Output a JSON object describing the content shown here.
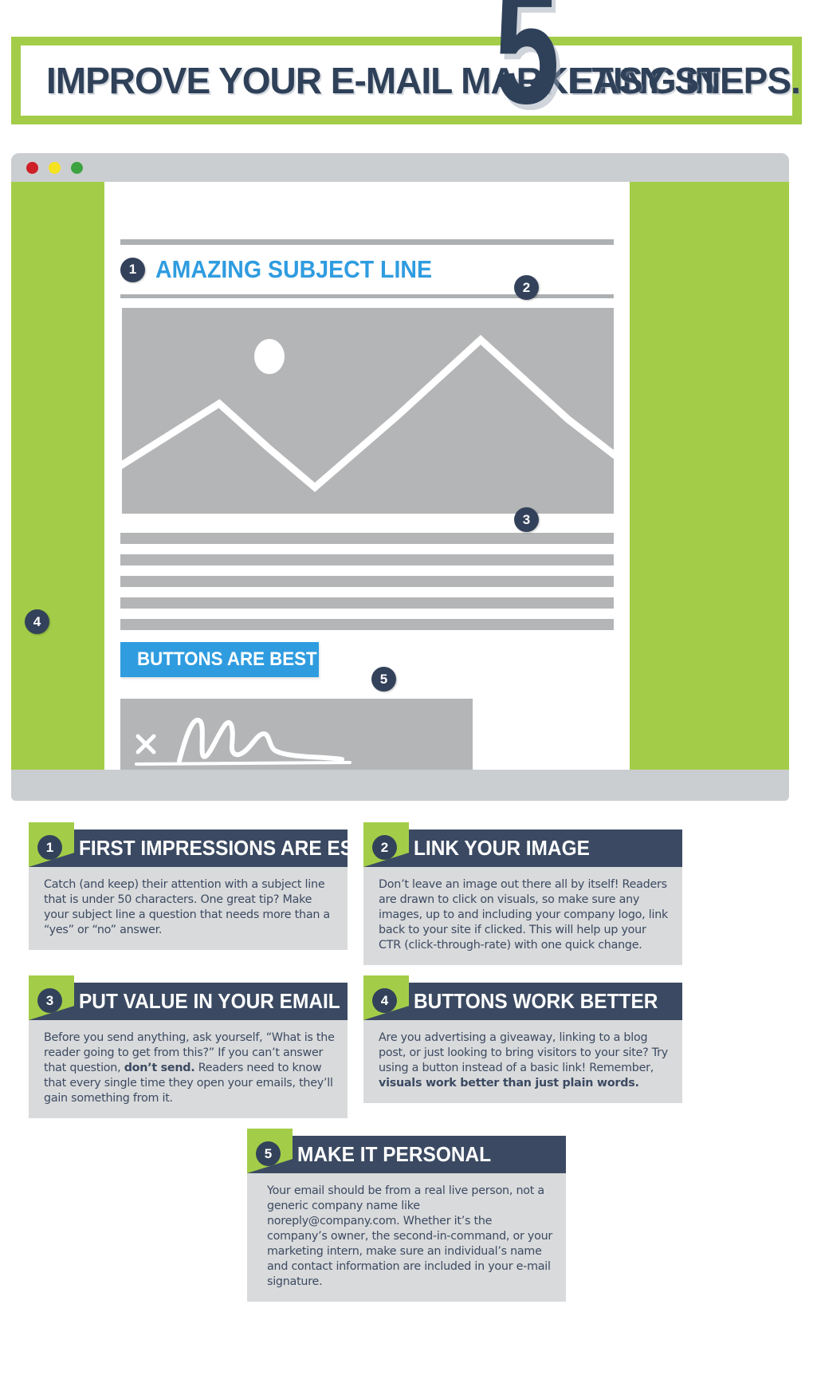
{
  "header": {
    "title_pre": "IMPROVE YOUR E-MAIL MARKETING IN",
    "big_number": "5",
    "title_post": "EASY STEPS."
  },
  "browser": {
    "traffic_lights": [
      "close-dot-red",
      "minimize-dot-yellow",
      "maximize-dot-green"
    ]
  },
  "email_preview": {
    "subject_marker": "1",
    "subject_line": "AMAZING SUBJECT LINE",
    "image_marker": "2",
    "body_marker": "3",
    "button_marker": "4",
    "button_label": "BUTTONS ARE BEST",
    "signature_marker": "5",
    "body_line_count": 5
  },
  "cards": [
    {
      "number": "1",
      "title": "FIRST IMPRESSIONS ARE ESSENTIAL",
      "body": "Catch (and keep) their attention with a subject line that is under 50 characters. One great tip? Make your subject line a question that needs more than a “yes” or “no” answer."
    },
    {
      "number": "2",
      "title": "LINK YOUR IMAGE",
      "body": "Don’t leave an image out there all by itself! Readers are drawn to click on visuals, so make sure any images, up to and including your company logo, link back to your site if clicked. This will help up your CTR (click-through-rate) with one quick change."
    },
    {
      "number": "3",
      "title": "PUT VALUE IN YOUR EMAIL",
      "body_part1": "Before you send anything, ask yourself, “What is the reader going to get from this?” If you can’t answer that question, ",
      "body_bold": "don’t send.",
      "body_part2": " Readers need to know that every single time they open your emails, they’ll gain something from it."
    },
    {
      "number": "4",
      "title": "BUTTONS WORK BETTER",
      "body_part1": "Are you advertising a giveaway, linking to a blog post, or just looking to bring visitors to your site? Try using a button instead of a basic link! Remember, ",
      "body_bold": "visuals work better than just plain words.",
      "body_part2": ""
    },
    {
      "number": "5",
      "title": "MAKE IT PERSONAL",
      "body": "Your email should be from a real live person, not a generic company name like noreply@company.com. Whether it’s the company’s owner, the second-in-command, or your marketing intern, make sure an individual’s name and contact information are included in your e-mail signature."
    }
  ],
  "colors": {
    "green": "#a3cd48",
    "navy": "#33425a",
    "card_head": "#3b4a62",
    "blue": "#2f9ce0",
    "gray_chrome": "#cbced1",
    "gray_placeholder": "#b3b5b7",
    "card_body_bg": "#d9dadb"
  }
}
